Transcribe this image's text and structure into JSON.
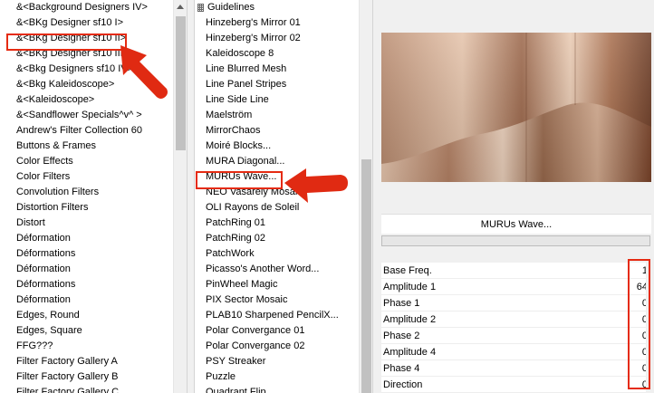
{
  "left_list": {
    "items": [
      "&<Background Designers IV>",
      "&<BKg Designer sf10 I>",
      "&<BKg Designer sf10 II>",
      "&<BKg Designer sf10 III>",
      "&<Bkg Designers sf10 IV>",
      "&<Bkg Kaleidoscope>",
      "&<Kaleidoscope>",
      "&<Sandflower Specials^v^ >",
      "Andrew's Filter Collection 60",
      "Buttons & Frames",
      "Color Effects",
      "Color Filters",
      "Convolution Filters",
      "Distortion Filters",
      "Distort",
      "Déformation",
      "Déformations",
      "Déformation",
      "Déformations",
      "Déformation",
      "Edges, Round",
      "Edges, Square",
      "FFG???",
      "Filter Factory Gallery A",
      "Filter Factory Gallery B",
      "Filter Factory Gallery C"
    ],
    "highlighted_index": 2
  },
  "mid_list": {
    "group_label": "Guidelines",
    "items": [
      "Hinzeberg's Mirror 01",
      "Hinzeberg's Mirror 02",
      "Kaleidoscope 8",
      "Line Blurred Mesh",
      "Line Panel Stripes",
      "Line Side Line",
      "Maelström",
      "MirrorChaos",
      "Moiré Blocks...",
      "MURA Diagonal...",
      "MURUs Wave...",
      "NEO Vasarely Mosaics",
      "OLI Rayons de Soleil",
      "PatchRing 01",
      "PatchRing 02",
      "PatchWork",
      "Picasso's Another Word...",
      "PinWheel Magic",
      "PIX Sector Mosaic",
      "PLAB10 Sharpened PencilX...",
      "Polar Convergance 01",
      "Polar Convergance 02",
      "PSY Streaker",
      "Puzzle",
      "Quadrant Flip"
    ],
    "selected_label": "MURUs Wave..."
  },
  "filter": {
    "name": "MURUs Wave...",
    "params": [
      {
        "label": "Base Freq.",
        "value": "1"
      },
      {
        "label": "Amplitude 1",
        "value": "64"
      },
      {
        "label": "Phase 1",
        "value": "0"
      },
      {
        "label": "Amplitude 2",
        "value": "0"
      },
      {
        "label": "Phase 2",
        "value": "0"
      },
      {
        "label": "Amplitude 4",
        "value": "0"
      },
      {
        "label": "Phase 4",
        "value": "0"
      },
      {
        "label": "Direction",
        "value": "0"
      }
    ]
  },
  "colors": {
    "highlight": "#e52b12",
    "pointer_arrow": "#e02a12",
    "preview_dark": "#6b3a23",
    "preview_light": "#e8c6ad"
  }
}
